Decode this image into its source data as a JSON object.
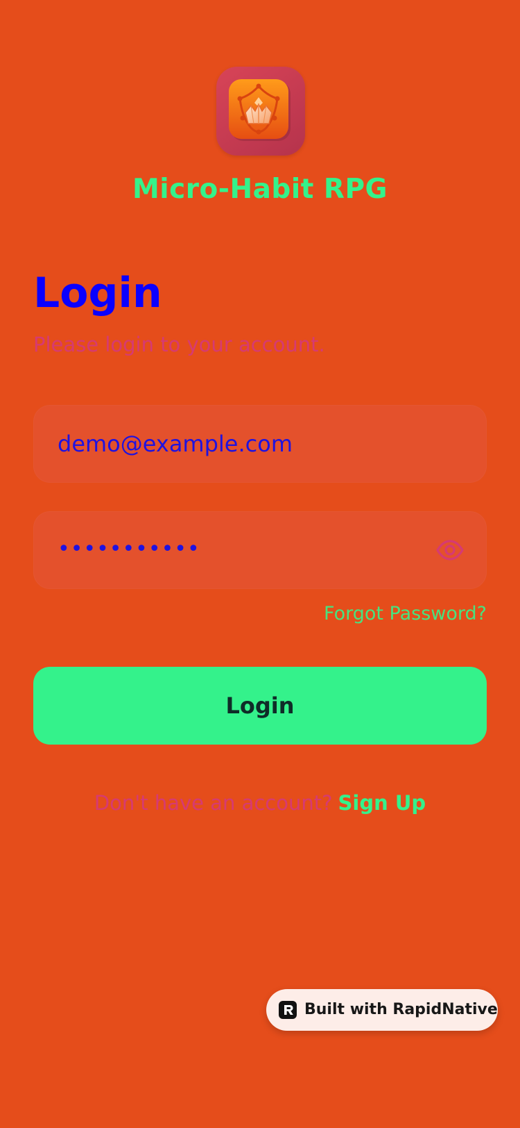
{
  "app": {
    "title": "Micro-Habit RPG",
    "icon": "app-logo-icon"
  },
  "login": {
    "heading": "Login",
    "subtitle": "Please login to your account.",
    "email": {
      "value": "demo@example.com"
    },
    "password": {
      "value": "demo1234567",
      "icon": "eye-icon"
    },
    "forgot_label": "Forgot Password?",
    "button_label": "Login",
    "signup_prompt": "Don't have an account?",
    "signup_label": "Sign Up"
  },
  "badge": {
    "label": "Built with RapidNative",
    "icon": "rapidnative-logo-icon"
  },
  "colors": {
    "background": "#E54D1B",
    "accent_green": "#34F28B",
    "heading_blue": "#0A00FF",
    "muted_pink": "#D63A72"
  }
}
